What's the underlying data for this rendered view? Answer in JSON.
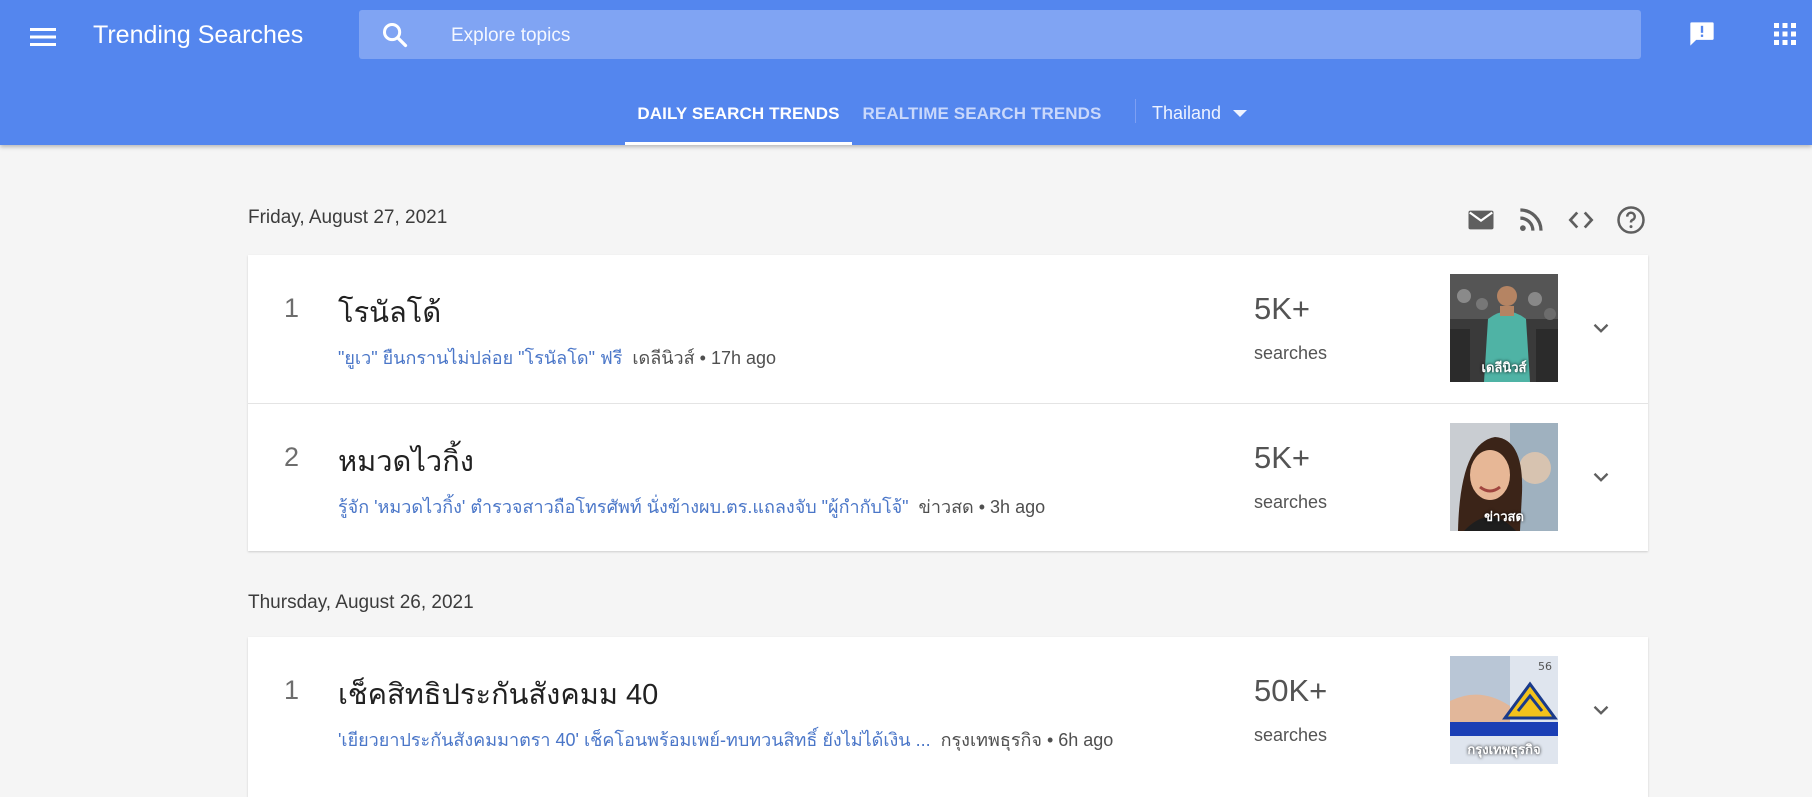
{
  "header": {
    "app_title": "Trending Searches",
    "search_placeholder": "Explore topics",
    "tabs": [
      {
        "label": "DAILY SEARCH TRENDS",
        "active": true
      },
      {
        "label": "REALTIME SEARCH TRENDS",
        "active": false
      }
    ],
    "geo": "Thailand",
    "icons": [
      "menu-icon",
      "search-icon",
      "feedback-icon",
      "apps-grid-icon"
    ]
  },
  "toolbar_icons": [
    "email-icon",
    "rss-icon",
    "embed-code-icon",
    "help-icon"
  ],
  "days": [
    {
      "date": "Friday, August 27, 2021",
      "items": [
        {
          "rank": "1",
          "title": "โรนัลโด้",
          "article": "\"ยูเว\" ยืนกรานไม่ปล่อย \"โรนัลโด\" ฟรี",
          "meta": "เดลีนิวส์ • 17h ago",
          "count": "5K+",
          "count_label": "searches",
          "thumb_caption": "เดลีนิวส์"
        },
        {
          "rank": "2",
          "title": "หมวดไวกิ้ง",
          "article": "รู้จัก 'หมวดไวกิ้ง' ตำรวจสาวถือโทรศัพท์ นั่งข้างผบ.ตร.แถลงจับ \"ผู้กำกับโจ้\"",
          "meta": "ข่าวสด • 3h ago",
          "count": "5K+",
          "count_label": "searches",
          "thumb_caption": "ข่าวสด"
        }
      ]
    },
    {
      "date": "Thursday, August 26, 2021",
      "items": [
        {
          "rank": "1",
          "title": "เช็คสิทธิประกันสังคมม 40",
          "article": "'เยียวยาประกันสังคมมาตรา 40' เช็คโอนพร้อมเพย์-ทบทวนสิทธิ์ ยังไม่ได้เงิน ...",
          "meta": "กรุงเทพธุรกิจ • 6h ago",
          "count": "50K+",
          "count_label": "searches",
          "thumb_caption": "กรุงเทพธุรกิจ"
        }
      ]
    }
  ],
  "colors": {
    "header_bg": "#5486ee",
    "search_bg": "#80a4f3",
    "link": "#4a76c8",
    "page_bg": "#f5f5f5"
  }
}
